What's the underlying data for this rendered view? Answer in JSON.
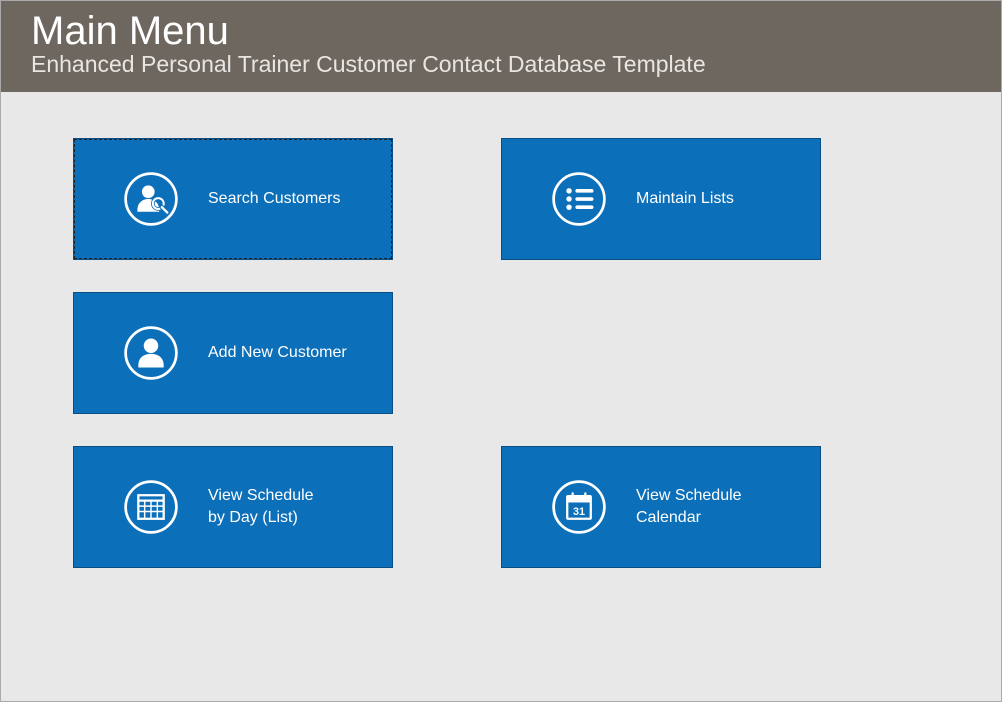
{
  "header": {
    "title": "Main Menu",
    "subtitle": "Enhanced Personal Trainer Customer Contact Database Template"
  },
  "tiles": {
    "search_customers": {
      "label": "Search Customers",
      "icon": "person-search-icon"
    },
    "maintain_lists": {
      "label": "Maintain Lists",
      "icon": "list-icon"
    },
    "add_customer": {
      "label": "Add New Customer",
      "icon": "person-add-icon"
    },
    "view_schedule_list": {
      "label": "View Schedule\nby Day (List)",
      "icon": "grid-calendar-icon"
    },
    "view_schedule_calendar": {
      "label": "View Schedule\nCalendar",
      "icon": "date-calendar-icon"
    }
  },
  "colors": {
    "header_bg": "#6e675f",
    "tile_bg": "#0c6fb9",
    "page_bg": "#e8e8e8"
  }
}
